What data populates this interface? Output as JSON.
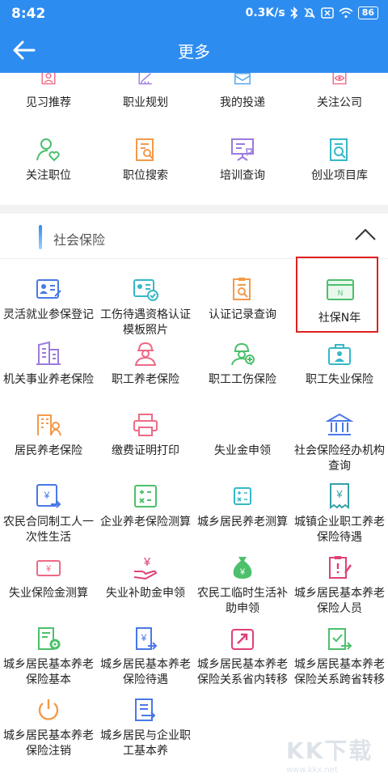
{
  "status": {
    "time": "8:42",
    "speed": "0.3K/s",
    "battery": "86"
  },
  "nav": {
    "title": "更多"
  },
  "section1": {
    "rows": [
      [
        {
          "label": "见习推荐"
        },
        {
          "label": "职业规划"
        },
        {
          "label": "我的投递"
        },
        {
          "label": "关注公司"
        }
      ],
      [
        {
          "label": "关注职位"
        },
        {
          "label": "职位搜索"
        },
        {
          "label": "培训查询"
        },
        {
          "label": "创业项目库"
        }
      ]
    ]
  },
  "section2": {
    "title": "社会保险",
    "items": [
      {
        "label": "灵活就业参保登记"
      },
      {
        "label": "工伤待遇资格认证模板照片"
      },
      {
        "label": "认证记录查询"
      },
      {
        "label": "社保N年"
      },
      {
        "label": "机关事业养老保险"
      },
      {
        "label": "职工养老保险"
      },
      {
        "label": "职工工伤保险"
      },
      {
        "label": "职工失业保险"
      },
      {
        "label": "居民养老保险"
      },
      {
        "label": "缴费证明打印"
      },
      {
        "label": "失业金申领"
      },
      {
        "label": "社会保险经办机构查询"
      },
      {
        "label": "农民合同制工人一次性生活"
      },
      {
        "label": "企业养老保险测算"
      },
      {
        "label": "城乡居民养老测算"
      },
      {
        "label": "城镇企业职工养老保险待遇"
      },
      {
        "label": "失业保险金测算"
      },
      {
        "label": "失业补助金申领"
      },
      {
        "label": "农民工临时生活补助申领"
      },
      {
        "label": "城乡居民基本养老保险人员"
      },
      {
        "label": "城乡居民基本养老保险基本"
      },
      {
        "label": "城乡居民基本养老保险待遇"
      },
      {
        "label": "城乡居民基本养老保险关系省内转移"
      },
      {
        "label": "城乡居民基本养老保险关系跨省转移"
      },
      {
        "label": "城乡居民基本养老保险注销"
      },
      {
        "label": "城乡居民与企业职工基本养"
      }
    ],
    "card_icon_text": "N"
  },
  "watermark": {
    "big": "KK下载",
    "small": "www.kkx.net"
  },
  "colors": {
    "primary": "#2d8cf0",
    "highlight": "#e02020"
  }
}
